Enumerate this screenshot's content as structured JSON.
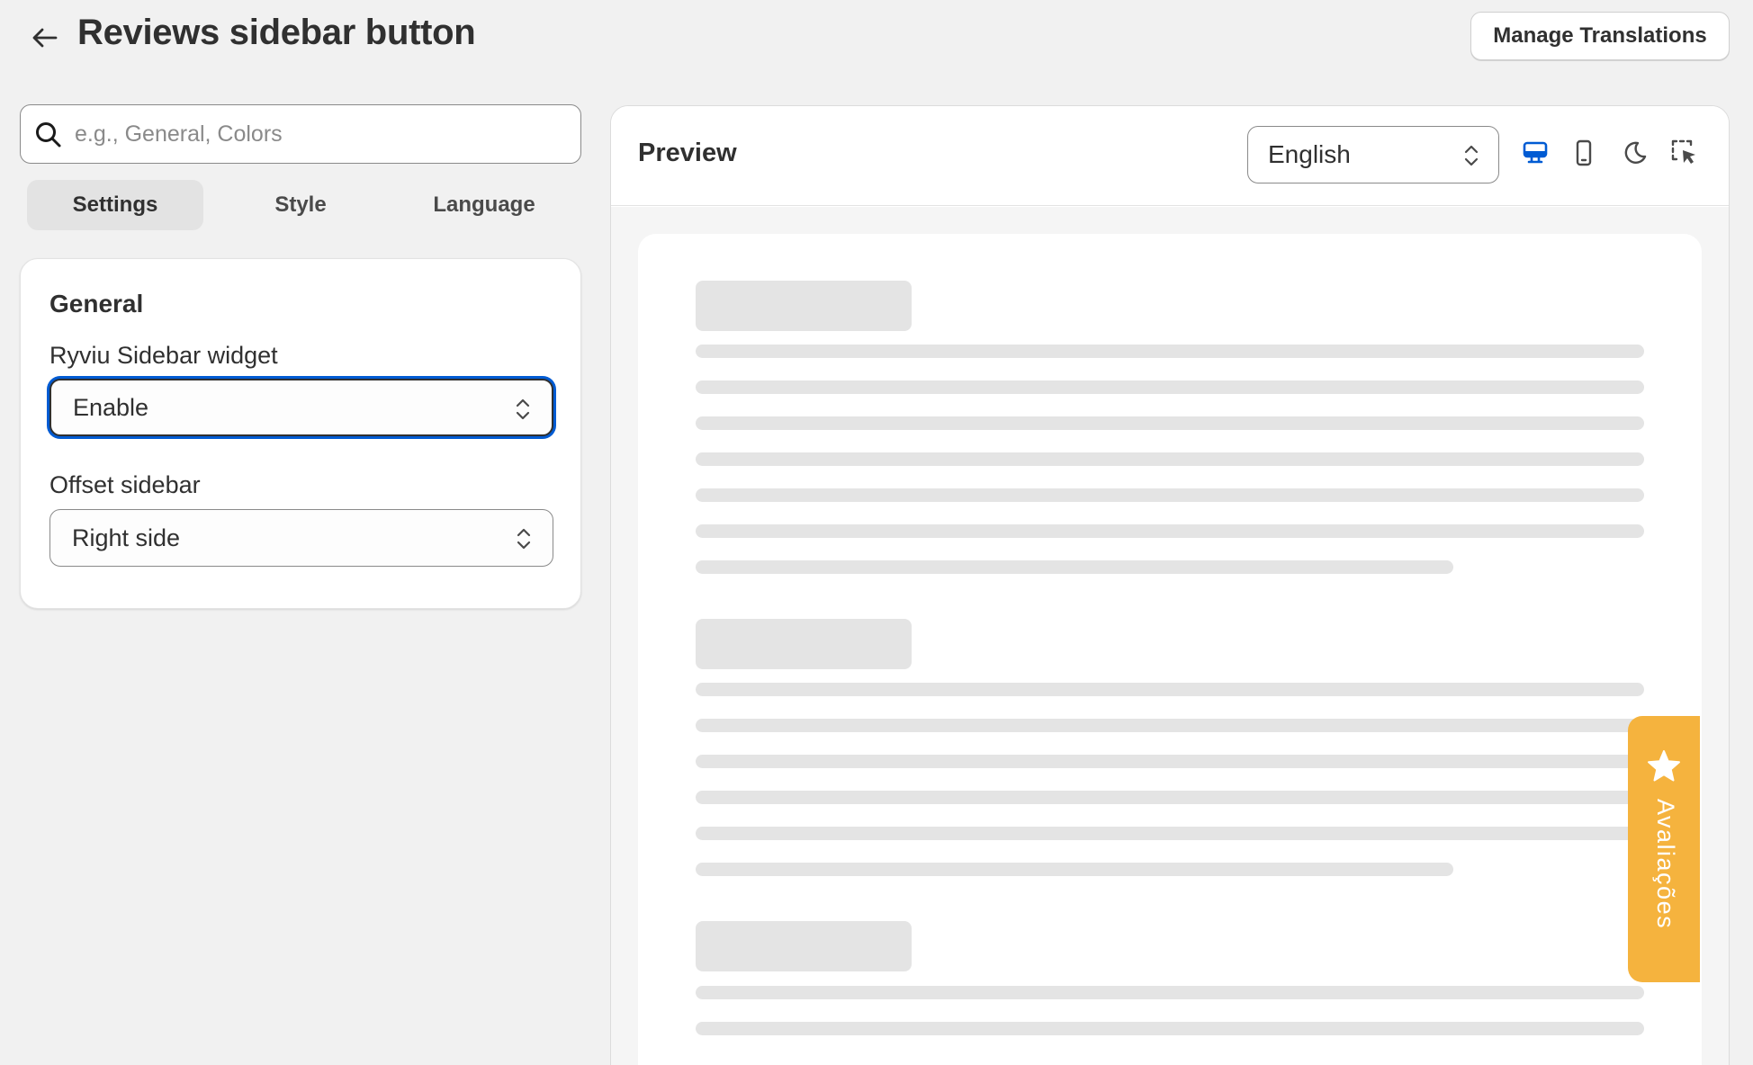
{
  "header": {
    "title": "Reviews sidebar button",
    "manage_translations_label": "Manage Translations"
  },
  "search": {
    "placeholder": "e.g., General, Colors",
    "value": ""
  },
  "tabs": [
    {
      "label": "Settings",
      "active": true
    },
    {
      "label": "Style",
      "active": false
    },
    {
      "label": "Language",
      "active": false
    }
  ],
  "general_card": {
    "title": "General",
    "fields": [
      {
        "label": "Ryviu Sidebar widget",
        "value": "Enable"
      },
      {
        "label": "Offset sidebar",
        "value": "Right side"
      }
    ]
  },
  "preview": {
    "title": "Preview",
    "language": "English",
    "tools": [
      "desktop-icon",
      "mobile-icon",
      "moon-icon",
      "select-element-icon"
    ],
    "active_tool": "desktop-icon",
    "accent_color": "#005bd3"
  },
  "floating_tab": {
    "label": "Avaliações",
    "icon": "star-icon",
    "color": "#f5b33e"
  }
}
